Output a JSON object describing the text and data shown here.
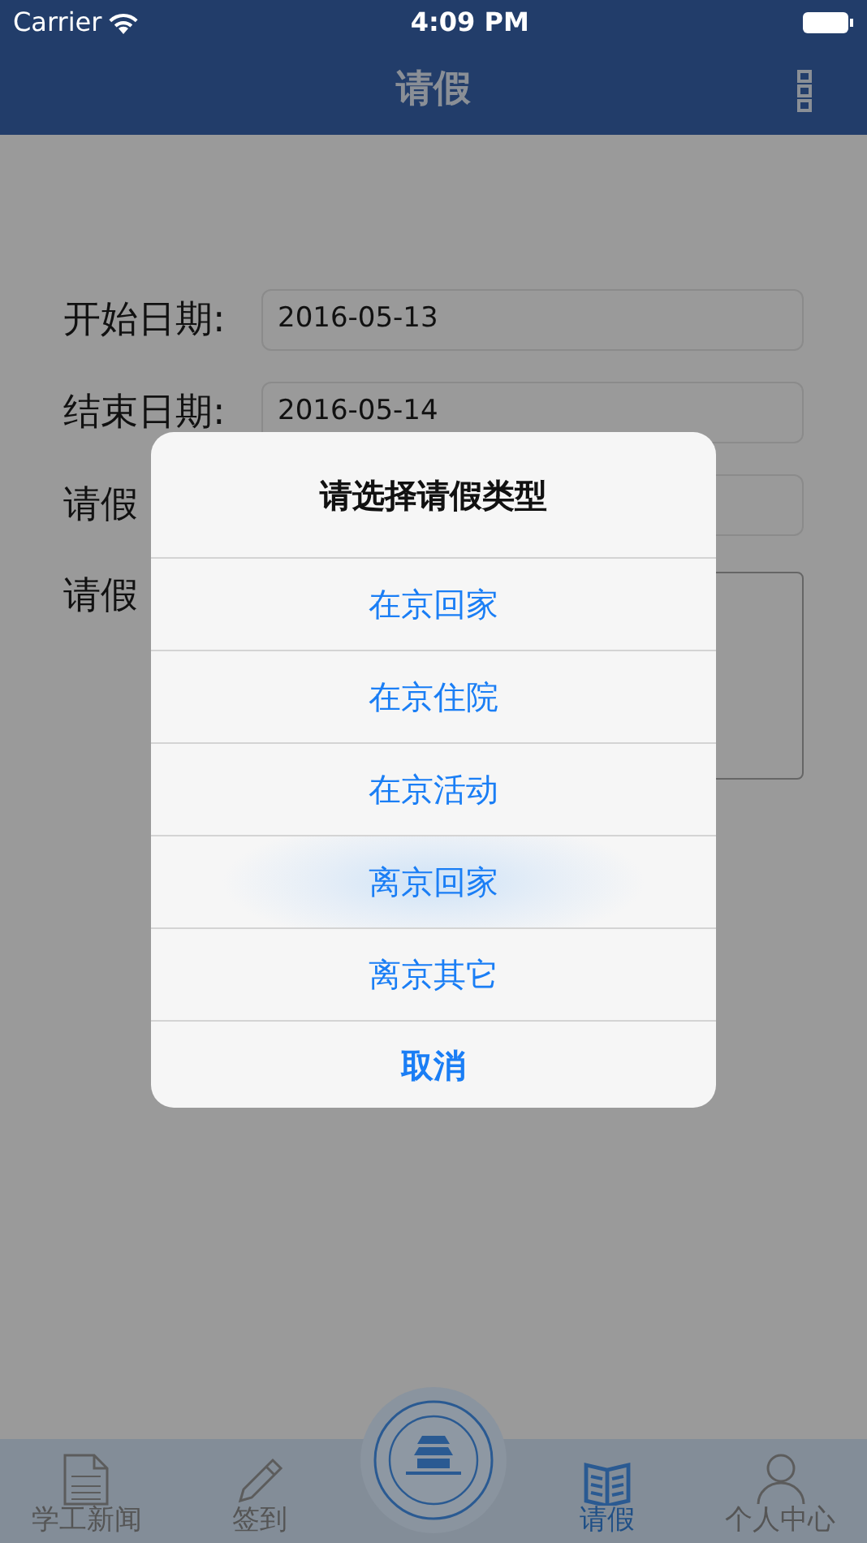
{
  "status_bar": {
    "carrier": "Carrier",
    "time": "4:09 PM"
  },
  "nav": {
    "title": "请假"
  },
  "form": [
    {
      "label": "开始日期:",
      "value": "2016-05-13",
      "kind": "input"
    },
    {
      "label": "结束日期:",
      "value": "2016-05-14",
      "kind": "input"
    },
    {
      "label": "请假",
      "kind": "input"
    },
    {
      "label": "请假",
      "kind": "textarea"
    }
  ],
  "dialog": {
    "title": "请选择请假类型",
    "options": [
      {
        "label": "在京回家",
        "selected": false
      },
      {
        "label": "在京住院",
        "selected": false
      },
      {
        "label": "在京活动",
        "selected": false
      },
      {
        "label": "离京回家",
        "selected": true
      },
      {
        "label": "离京其它",
        "selected": false
      }
    ],
    "cancel": "取消"
  },
  "tabs": [
    {
      "label": "学工新闻",
      "kind": "news",
      "selected": false
    },
    {
      "label": "签到",
      "kind": "pencil",
      "selected": false
    },
    {
      "label": "请假",
      "kind": "book",
      "selected": true
    },
    {
      "label": "个人中心",
      "kind": "person",
      "selected": false
    }
  ]
}
